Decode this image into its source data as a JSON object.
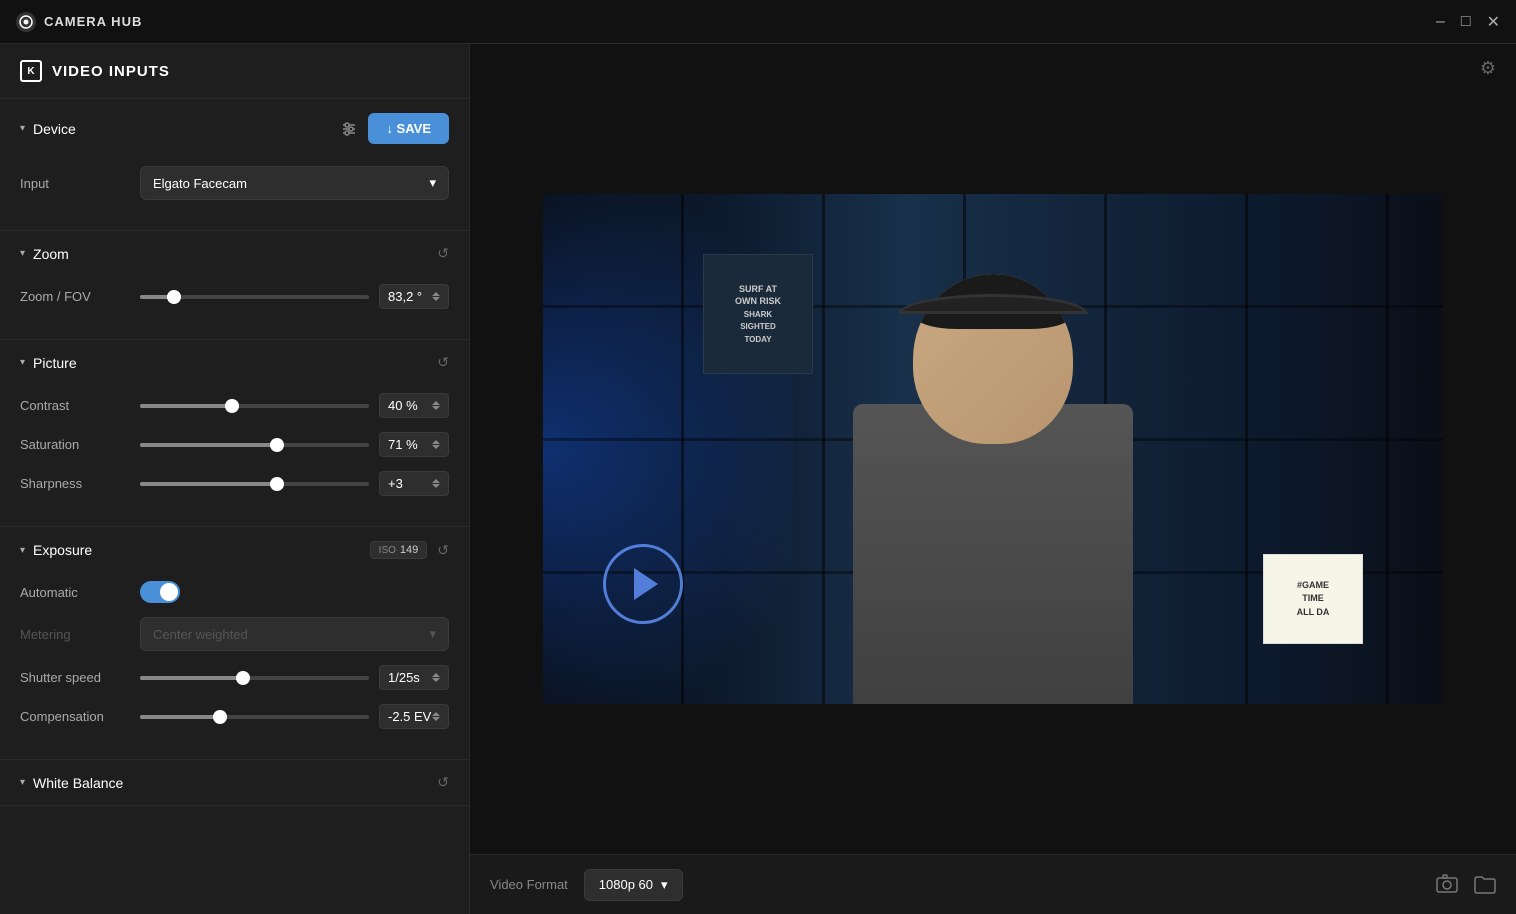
{
  "app": {
    "title": "CAMERA HUB",
    "icon_label": "C"
  },
  "titlebar": {
    "minimize": "–",
    "maximize": "□",
    "close": "✕"
  },
  "header": {
    "section_icon": "K",
    "title": "VIDEO INPUTS",
    "settings_icon": "⚙"
  },
  "device_section": {
    "label": "Device",
    "save_label": "↓ SAVE",
    "input_label": "Input",
    "input_value": "Elgato Facecam",
    "chevron": "▾"
  },
  "zoom_section": {
    "label": "Zoom",
    "zoom_fov_label": "Zoom / FOV",
    "zoom_fov_value": "83,2 °",
    "zoom_fill_pct": 15
  },
  "picture_section": {
    "label": "Picture",
    "contrast_label": "Contrast",
    "contrast_value": "40 %",
    "contrast_fill_pct": 40,
    "saturation_label": "Saturation",
    "saturation_value": "71 %",
    "saturation_fill_pct": 60,
    "sharpness_label": "Sharpness",
    "sharpness_value": "+3",
    "sharpness_fill_pct": 60
  },
  "exposure_section": {
    "label": "Exposure",
    "iso_label": "ISO",
    "iso_value": "149",
    "automatic_label": "Automatic",
    "metering_label": "Metering",
    "metering_value": "Center weighted",
    "shutter_label": "Shutter speed",
    "shutter_value": "1/25s",
    "shutter_fill_pct": 45,
    "compensation_label": "Compensation",
    "compensation_value": "-2.5 EV",
    "compensation_fill_pct": 35
  },
  "white_balance_section": {
    "label": "White Balance"
  },
  "bottom": {
    "format_label": "Video Format",
    "format_value": "1080p 60",
    "chevron": "▾"
  },
  "icons": {
    "chevron_down": "▾",
    "reset": "↺",
    "settings": "⚙",
    "screenshot": "📷",
    "folder": "🗀"
  }
}
